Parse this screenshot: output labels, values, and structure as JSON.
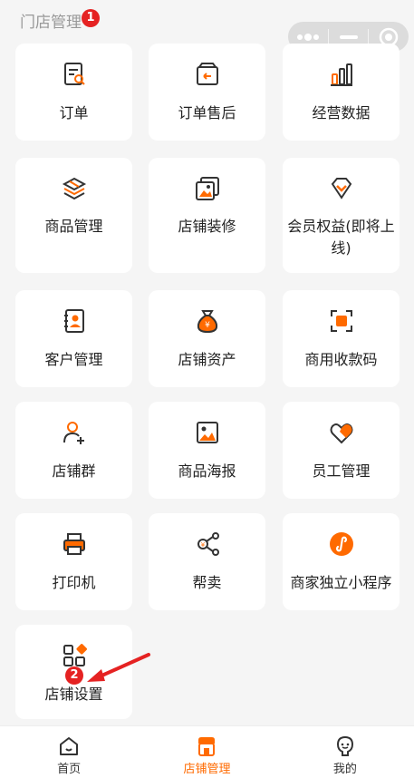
{
  "header": {
    "title": "门店管理"
  },
  "annotations": {
    "step1": "1",
    "step2": "2"
  },
  "colors": {
    "accent": "#ff6a00",
    "icon_dark": "#333333",
    "badge": "#e52222"
  },
  "tiles": [
    {
      "label": "订单",
      "icon": "order-icon"
    },
    {
      "label": "订单售后",
      "icon": "after-sales-icon"
    },
    {
      "label": "经营数据",
      "icon": "bar-chart-icon"
    },
    {
      "label": "商品管理",
      "icon": "layers-icon"
    },
    {
      "label": "店铺装修",
      "icon": "image-stack-icon"
    },
    {
      "label": "会员权益(即将上线)",
      "label_line1": "会员权益(即将上",
      "label_line2": "线)",
      "icon": "diamond-icon"
    },
    {
      "label": "客户管理",
      "icon": "contact-book-icon"
    },
    {
      "label": "店铺资产",
      "icon": "money-bag-icon"
    },
    {
      "label": "商用收款码",
      "icon": "qr-scan-icon"
    },
    {
      "label": "店铺群",
      "icon": "user-add-icon"
    },
    {
      "label": "商品海报",
      "icon": "poster-icon"
    },
    {
      "label": "员工管理",
      "icon": "handshake-heart-icon"
    },
    {
      "label": "打印机",
      "icon": "printer-icon"
    },
    {
      "label": "帮卖",
      "icon": "share-icon"
    },
    {
      "label": "商家独立小程序",
      "icon": "mini-program-icon"
    },
    {
      "label": "店铺设置",
      "icon": "apps-icon"
    }
  ],
  "bottom_nav": [
    {
      "label": "首页",
      "icon": "home-icon",
      "active": false
    },
    {
      "label": "店铺管理",
      "icon": "store-icon",
      "active": true
    },
    {
      "label": "我的",
      "icon": "profile-icon",
      "active": false
    }
  ]
}
